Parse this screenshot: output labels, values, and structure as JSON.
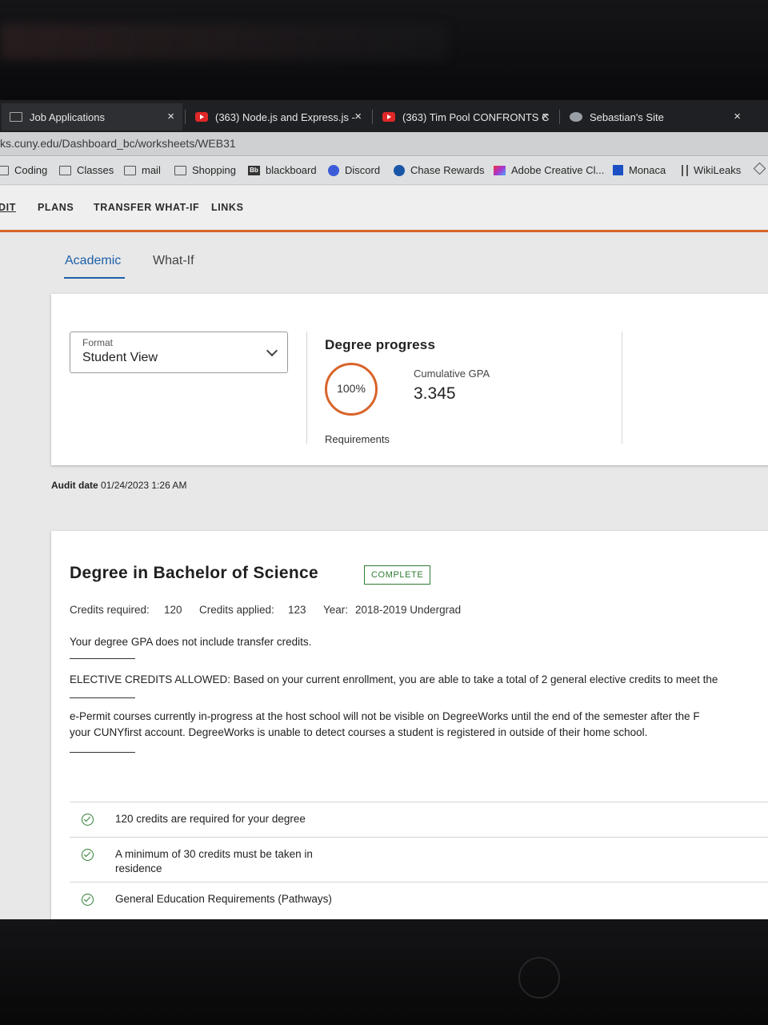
{
  "browser": {
    "tabs": [
      {
        "title": "Job Applications",
        "favicon": "folder-icon",
        "close": "×"
      },
      {
        "title": "(363) Node.js and Express.js -",
        "favicon": "youtube-icon",
        "close": "×"
      },
      {
        "title": "(363) Tim Pool CONFRONTS C",
        "favicon": "youtube-icon",
        "close": "×"
      },
      {
        "title": "Sebastian's Site",
        "favicon": "site-icon",
        "close": "×"
      }
    ],
    "url": "ks.cuny.edu/Dashboard_bc/worksheets/WEB31",
    "bookmarks": [
      {
        "label": "Coding",
        "icon": "folder-icon"
      },
      {
        "label": "Classes",
        "icon": "folder-icon"
      },
      {
        "label": "mail",
        "icon": "folder-icon"
      },
      {
        "label": "Shopping",
        "icon": "folder-icon"
      },
      {
        "label": "blackboard",
        "icon": "blackboard-icon",
        "badge": "Bb"
      },
      {
        "label": "Discord",
        "icon": "discord-icon"
      },
      {
        "label": "Chase Rewards",
        "icon": "chase-icon"
      },
      {
        "label": "Adobe Creative Cl...",
        "icon": "adobe-icon"
      },
      {
        "label": "Monaca",
        "icon": "monaca-icon"
      },
      {
        "label": "WikiLeaks",
        "icon": "wikileaks-icon"
      }
    ]
  },
  "app_nav": {
    "items": [
      "DIT",
      "PLANS",
      "TRANSFER WHAT-IF",
      "LINKS"
    ]
  },
  "view_tabs": {
    "academic": "Academic",
    "whatif": "What-If"
  },
  "summary": {
    "format_label": "Format",
    "format_value": "Student View",
    "degree_progress_title": "Degree progress",
    "requirements_percent": "100%",
    "requirements_label": "Requirements",
    "gpa_label": "Cumulative GPA",
    "gpa_value": "3.345"
  },
  "audit": {
    "label": "Audit date",
    "value": "01/24/2023 1:26 AM"
  },
  "degree": {
    "title": "Degree in Bachelor of Science",
    "status": "COMPLETE",
    "credits_required_label": "Credits required:",
    "credits_required": "120",
    "credits_applied_label": "Credits applied:",
    "credits_applied": "123",
    "year_label": "Year:",
    "year": "2018-2019 Undergrad",
    "gpa_note": "Your degree GPA does not include transfer credits.",
    "elective_note": "ELECTIVE CREDITS ALLOWED: Based on your current enrollment, you are able to take a total of 2 general elective credits to meet the",
    "epermit_line1": "e-Permit courses currently in-progress at the host school will not be visible on DegreeWorks until the end of the semester after the F",
    "epermit_line2": "your CUNYfirst account. DegreeWorks is unable to detect courses a student is registered in outside of their home school.",
    "requirements": [
      "120 credits are required for your degree",
      "A minimum of 30 credits must be taken in residence",
      "General Education Requirements (Pathways)"
    ]
  },
  "colors": {
    "accent": "#d9642a",
    "link": "#1d5fa8",
    "complete": "#2e7d32"
  }
}
